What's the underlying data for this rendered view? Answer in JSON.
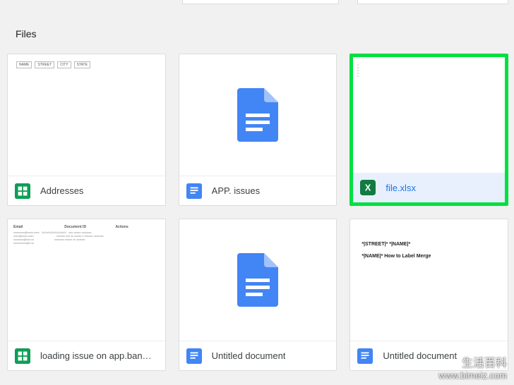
{
  "section_title": "Files",
  "files": [
    {
      "name": "Addresses",
      "type": "sheets",
      "selected": false
    },
    {
      "name": "APP. issues",
      "type": "docs",
      "selected": false
    },
    {
      "name": "file.xlsx",
      "type": "excel",
      "selected": true
    },
    {
      "name": "loading issue on app.ban…",
      "type": "sheets",
      "selected": false
    },
    {
      "name": "Untitled document",
      "type": "docs",
      "selected": false
    },
    {
      "name": "Untitled document",
      "type": "docs",
      "selected": false
    }
  ],
  "preview": {
    "addresses_headers": [
      "NAME",
      "STREET",
      "CITY",
      "STATE"
    ],
    "labelmerge_lines": [
      "*|STREET|* *|NAME|*",
      "*|NAME|* How to Label Merge"
    ],
    "loading_cols": [
      "Email",
      "Document ID",
      "Actions"
    ]
  },
  "watermark": {
    "cn": "生活百科",
    "url": "www.bimeiz.com"
  }
}
